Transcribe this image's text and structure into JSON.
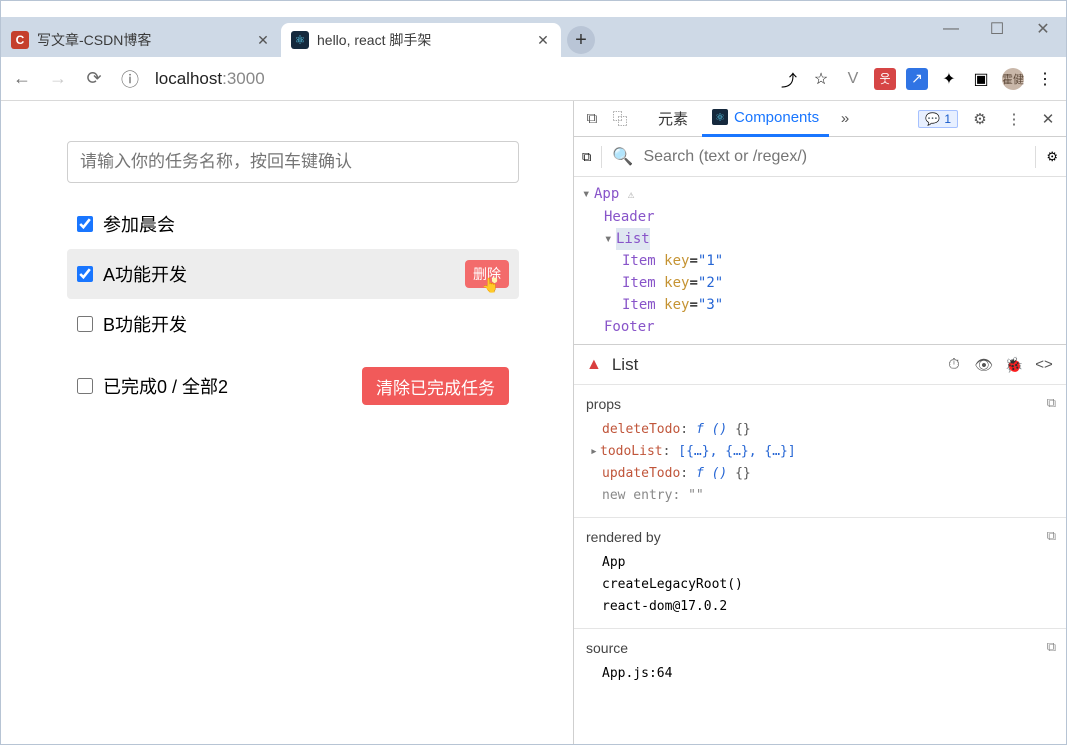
{
  "window": {
    "min": "—",
    "max": "☐",
    "close": "✕"
  },
  "tabs": [
    {
      "title": "写文章-CSDN博客",
      "active": false,
      "fav": "C"
    },
    {
      "title": "hello, react 脚手架",
      "active": true,
      "fav": "⚛"
    }
  ],
  "newtab": "+",
  "addr": {
    "info": "ⓘ",
    "host": "localhost",
    "port": ":3000",
    "share": "⤴",
    "star": "☆",
    "vue": "V",
    "ext1": "웃",
    "ext2": "↗",
    "puzzle": "✦",
    "panel": "▣",
    "avatar": "霍健",
    "kebab": "⋮"
  },
  "todo": {
    "placeholder": "请输入你的任务名称，按回车键确认",
    "items": [
      {
        "text": "参加晨会",
        "checked": true
      },
      {
        "text": "A功能开发",
        "checked": true,
        "hovered": true
      },
      {
        "text": "B功能开发",
        "checked": false
      }
    ],
    "delete_label": "删除",
    "footer_label": "已完成0 / 全部2",
    "clear_label": "清除已完成任务"
  },
  "devtools": {
    "tabs": {
      "elements": "元素",
      "components": "Components",
      "more": "»",
      "badge_count": "1",
      "gear": "⚙",
      "kebab": "⋮",
      "close": "✕"
    },
    "search": {
      "placeholder": "Search (text or /regex/)"
    },
    "tree": {
      "app": "App",
      "header": "Header",
      "list": "List",
      "items": [
        {
          "name": "Item",
          "key": "1"
        },
        {
          "name": "Item",
          "key": "2"
        },
        {
          "name": "Item",
          "key": "3"
        }
      ],
      "footer": "Footer",
      "keylit": "key"
    },
    "details": {
      "title": "List",
      "icons": {
        "sus": "⏱",
        "eye": "👁",
        "bug": "🐞",
        "brackets": "<>"
      },
      "props_title": "props",
      "props": [
        {
          "k": "deleteTodo",
          "v": "f ()",
          "extra": "{}"
        },
        {
          "k": "todoList",
          "caret": "▸",
          "v": "[{…}, {…}, {…}]"
        },
        {
          "k": "updateTodo",
          "v": "f ()",
          "extra": "{}"
        },
        {
          "k": "new entry",
          "v": "\"\"",
          "gray": true
        }
      ],
      "rendered_title": "rendered by",
      "rendered": [
        "App",
        "createLegacyRoot()",
        "react-dom@17.0.2"
      ],
      "source_title": "source",
      "source": [
        "App.js:64"
      ],
      "copy": "⧉"
    }
  }
}
